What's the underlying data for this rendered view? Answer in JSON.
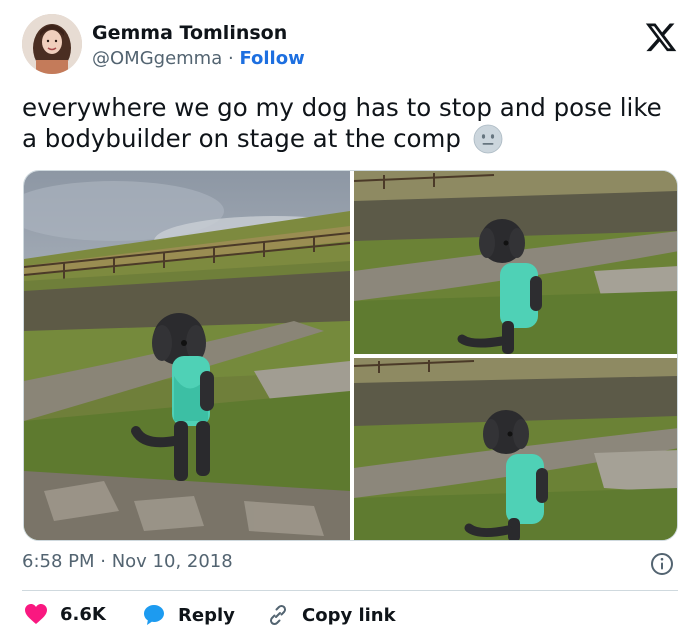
{
  "author": {
    "name": "Gemma Tomlinson",
    "handle": "@OMGgemma",
    "separator": "·",
    "follow_label": "Follow"
  },
  "platform_logo": "x-logo-icon",
  "tweet": {
    "text": "everywhere we go my dog has to stop and pose like a bodybuilder on stage at the comp",
    "emoji": "neutral-face-emoji",
    "media_count": 3
  },
  "timestamp": "6:58 PM · Nov 10, 2018",
  "actions": {
    "likes_count": "6.6K",
    "reply_label": "Reply",
    "copy_link_label": "Copy link"
  },
  "colors": {
    "text": "#0f1419",
    "secondary": "#536471",
    "link": "#1d6fe0",
    "like": "#f91880",
    "reply": "#1d9bf0"
  }
}
